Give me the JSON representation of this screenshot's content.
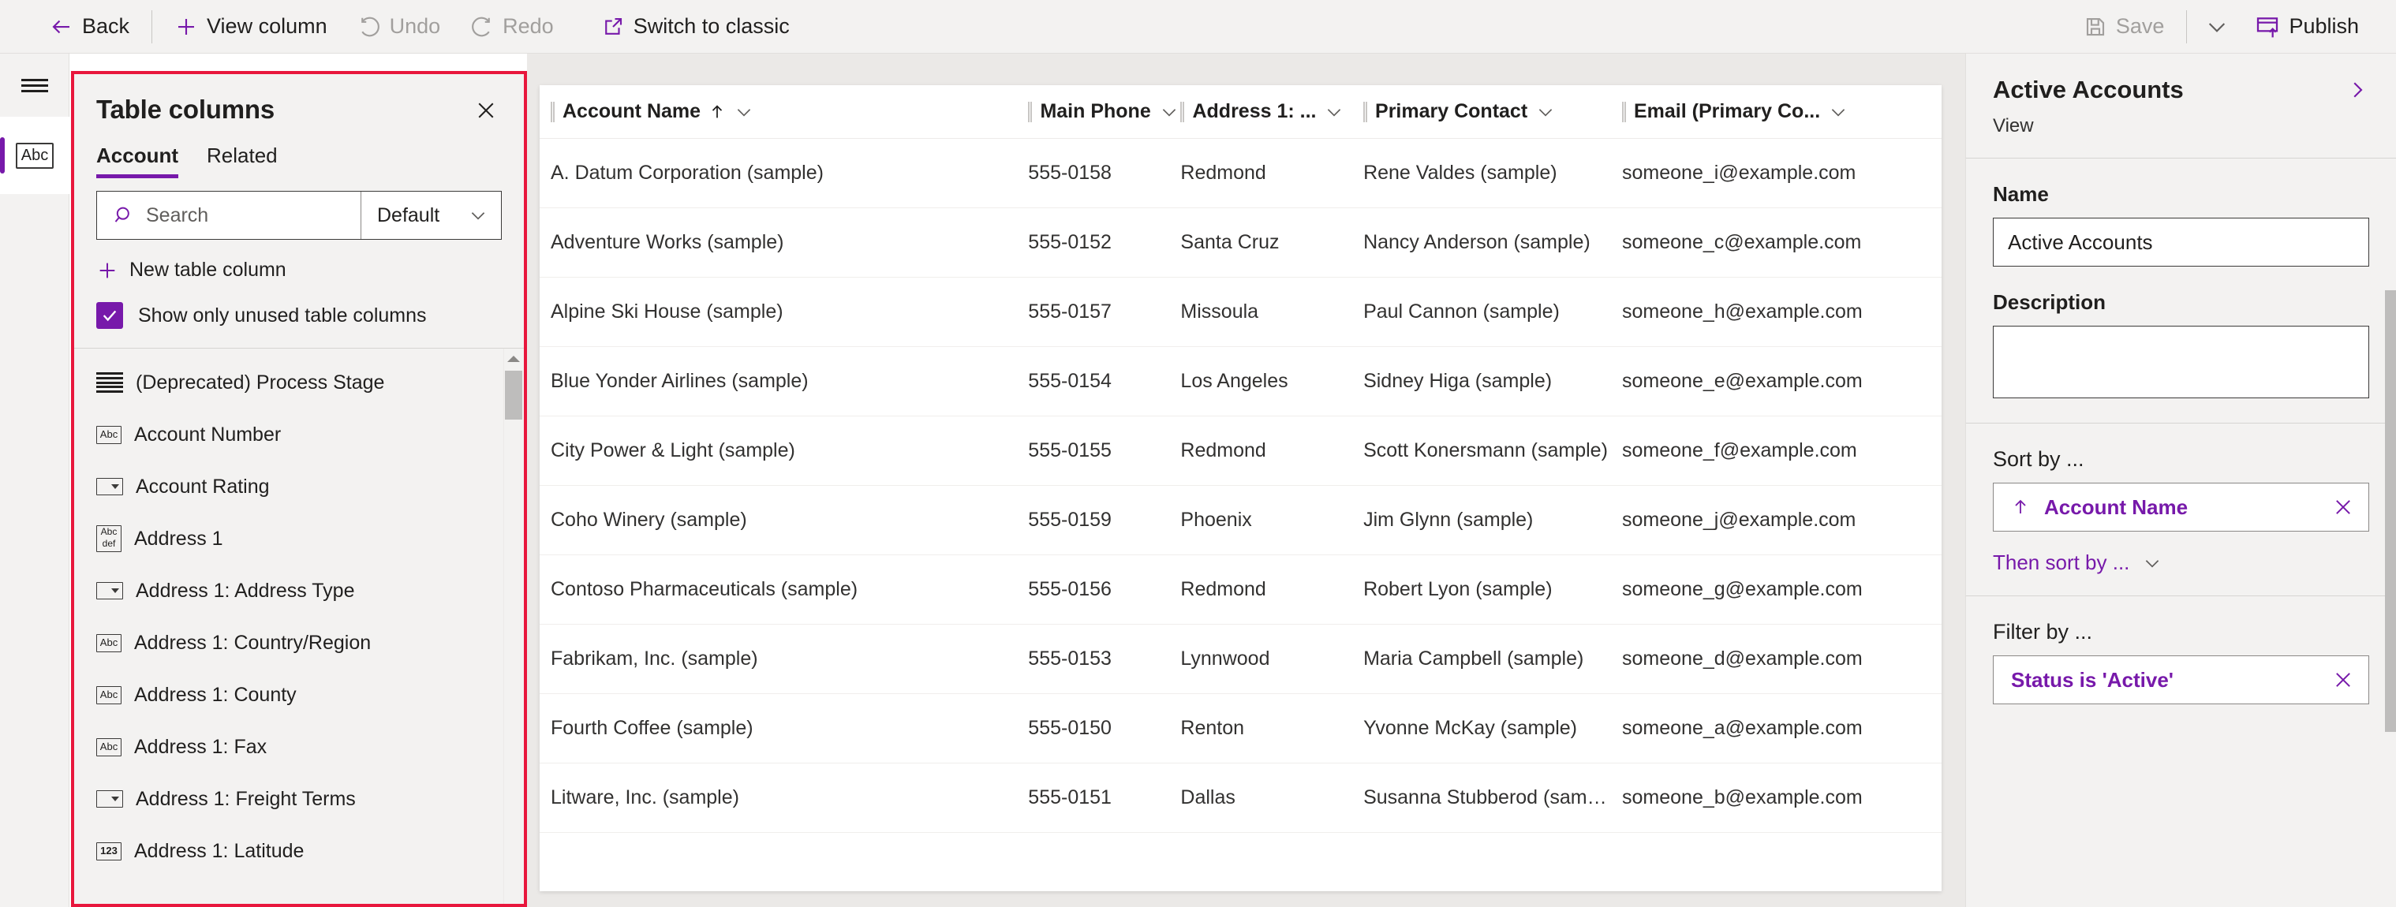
{
  "commandbar": {
    "back_label": "Back",
    "view_column_label": "View column",
    "undo_label": "Undo",
    "redo_label": "Redo",
    "switch_classic_label": "Switch to classic",
    "save_label": "Save",
    "publish_label": "Publish"
  },
  "rail": {
    "menu_label": "Menu",
    "item_label": "Abc"
  },
  "table_columns_panel": {
    "title": "Table columns",
    "close_label": "Close",
    "tabs": [
      {
        "label": "Account",
        "active": true
      },
      {
        "label": "Related",
        "active": false
      }
    ],
    "search": {
      "value": "",
      "placeholder": "Search"
    },
    "filter_select": {
      "value": "Default"
    },
    "new_column_label": "New table column",
    "show_unused": {
      "label": "Show only unused table columns",
      "checked": true
    },
    "columns": [
      {
        "label": "(Deprecated) Process Stage",
        "icon": "lines-icon"
      },
      {
        "label": "Account Number",
        "icon": "abc-icon"
      },
      {
        "label": "Account Rating",
        "icon": "option-set-icon"
      },
      {
        "label": "Address 1",
        "icon": "abcdef-icon"
      },
      {
        "label": "Address 1: Address Type",
        "icon": "option-set-icon"
      },
      {
        "label": "Address 1: Country/Region",
        "icon": "abc-icon"
      },
      {
        "label": "Address 1: County",
        "icon": "abc-icon"
      },
      {
        "label": "Address 1: Fax",
        "icon": "abc-icon"
      },
      {
        "label": "Address 1: Freight Terms",
        "icon": "option-set-icon"
      },
      {
        "label": "Address 1: Latitude",
        "icon": "number-icon"
      }
    ]
  },
  "grid": {
    "columns": [
      {
        "label": "Account Name",
        "sorted": true,
        "sort_dir": "asc"
      },
      {
        "label": "Main Phone",
        "sorted": false
      },
      {
        "label": "Address 1: ...",
        "sorted": false
      },
      {
        "label": "Primary Contact",
        "sorted": false
      },
      {
        "label": "Email (Primary Co...",
        "sorted": false
      }
    ],
    "rows": [
      [
        "A. Datum Corporation (sample)",
        "555-0158",
        "Redmond",
        "Rene Valdes (sample)",
        "someone_i@example.com"
      ],
      [
        "Adventure Works (sample)",
        "555-0152",
        "Santa Cruz",
        "Nancy Anderson (sample)",
        "someone_c@example.com"
      ],
      [
        "Alpine Ski House (sample)",
        "555-0157",
        "Missoula",
        "Paul Cannon (sample)",
        "someone_h@example.com"
      ],
      [
        "Blue Yonder Airlines (sample)",
        "555-0154",
        "Los Angeles",
        "Sidney Higa (sample)",
        "someone_e@example.com"
      ],
      [
        "City Power & Light (sample)",
        "555-0155",
        "Redmond",
        "Scott Konersmann (sample)",
        "someone_f@example.com"
      ],
      [
        "Coho Winery (sample)",
        "555-0159",
        "Phoenix",
        "Jim Glynn (sample)",
        "someone_j@example.com"
      ],
      [
        "Contoso Pharmaceuticals (sample)",
        "555-0156",
        "Redmond",
        "Robert Lyon (sample)",
        "someone_g@example.com"
      ],
      [
        "Fabrikam, Inc. (sample)",
        "555-0153",
        "Lynnwood",
        "Maria Campbell (sample)",
        "someone_d@example.com"
      ],
      [
        "Fourth Coffee (sample)",
        "555-0150",
        "Renton",
        "Yvonne McKay (sample)",
        "someone_a@example.com"
      ],
      [
        "Litware, Inc. (sample)",
        "555-0151",
        "Dallas",
        "Susanna Stubberod (samp...",
        "someone_b@example.com"
      ]
    ]
  },
  "properties": {
    "title": "Active Accounts",
    "subtitle": "View",
    "expand_label": "Expand",
    "name_label": "Name",
    "name_value": "Active Accounts",
    "description_label": "Description",
    "description_value": "",
    "sort_by_label": "Sort by ...",
    "sort_chip": {
      "label": "Account Name",
      "direction": "asc"
    },
    "then_sort_label": "Then sort by ...",
    "filter_by_label": "Filter by ...",
    "filter_chip": {
      "label": "Status is 'Active'"
    }
  },
  "colors": {
    "accent": "#7719aa",
    "annotation": "#e8173d",
    "chrome": "#f3f2f1",
    "canvas": "#ebe9e7"
  }
}
